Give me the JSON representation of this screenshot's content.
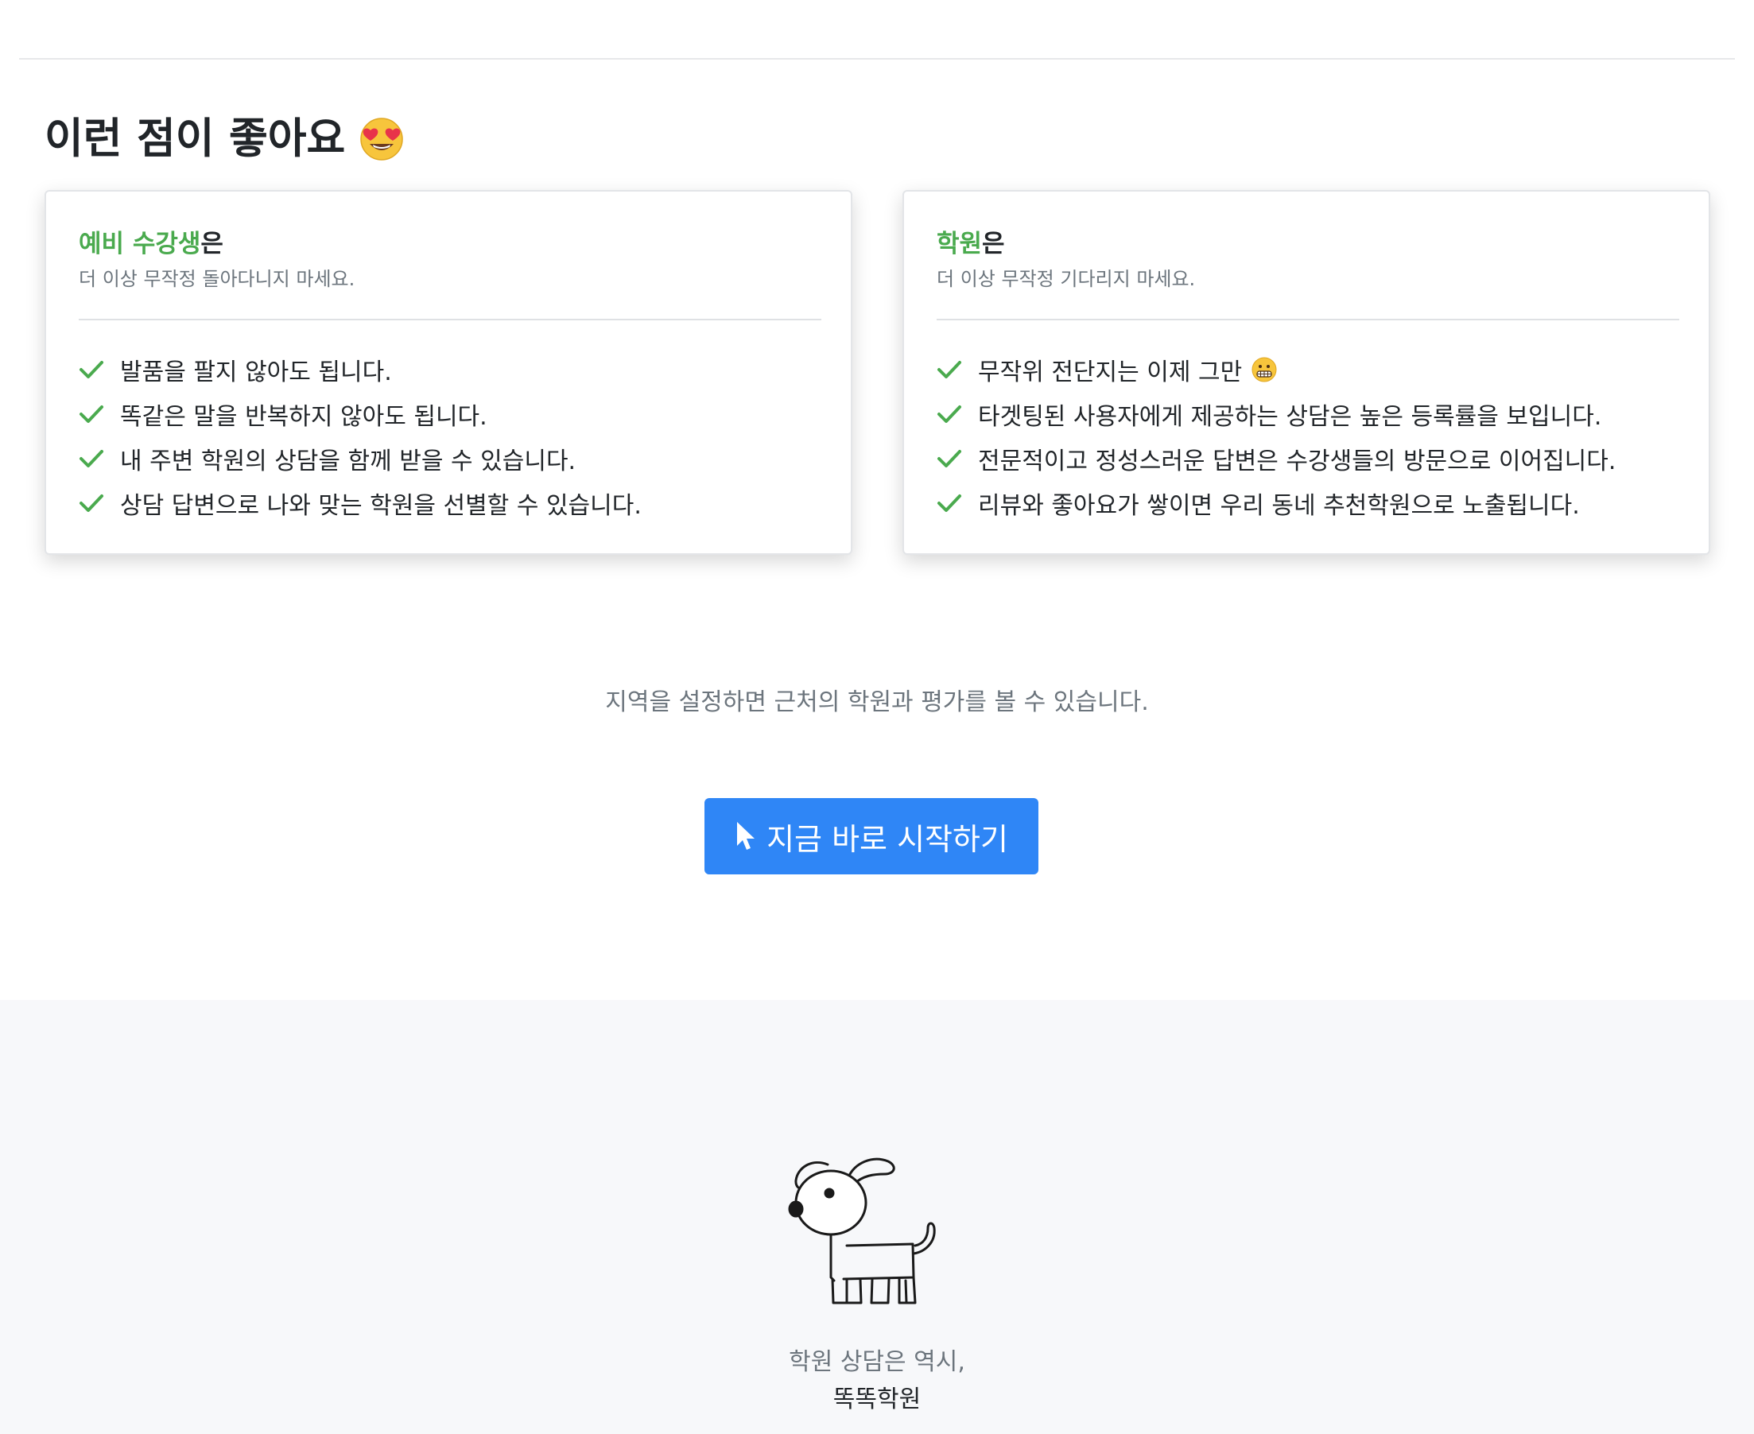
{
  "section": {
    "title": "이런 점이 좋아요",
    "title_emoji": "heart-eyes-emoji"
  },
  "students_card": {
    "heading_highlight": "예비 수강생",
    "heading_suffix": "은",
    "subtitle": "더 이상 무작정 돌아다니지 마세요.",
    "items": [
      "발품을 팔지 않아도 됩니다.",
      "똑같은 말을 반복하지 않아도 됩니다.",
      "내 주변 학원의 상담을 함께 받을 수 있습니다.",
      "상담 답변으로 나와 맞는 학원을 선별할 수 있습니다."
    ]
  },
  "academy_card": {
    "heading_highlight": "학원",
    "heading_suffix": "은",
    "subtitle": "더 이상 무작정 기다리지 마세요.",
    "items": [
      "무작위 전단지는 이제 그만",
      "타겟팅된 사용자에게 제공하는 상담은 높은 등록률을 보입니다.",
      "전문적이고 정성스러운 답변은 수강생들의 방문으로 이어집니다.",
      "리뷰와 좋아요가 쌓이면 우리 동네 추천학원으로 노출됩니다."
    ],
    "first_item_emoji": "grimacing-emoji"
  },
  "cta": {
    "description": "지역을 설정하면 근처의 학원과 평가를 볼 수 있습니다.",
    "button_label": "지금 바로 시작하기",
    "button_icon": "mouse-pointer-icon"
  },
  "footer": {
    "mascot": "dog-illustration",
    "tagline": "학원 상담은 역시,",
    "brand": "똑똑학원"
  },
  "colors": {
    "accent_green": "#4aaa4e",
    "button_blue": "#2f86f6",
    "muted_text": "#6c757d",
    "footer_bg": "#f7f8fa"
  }
}
